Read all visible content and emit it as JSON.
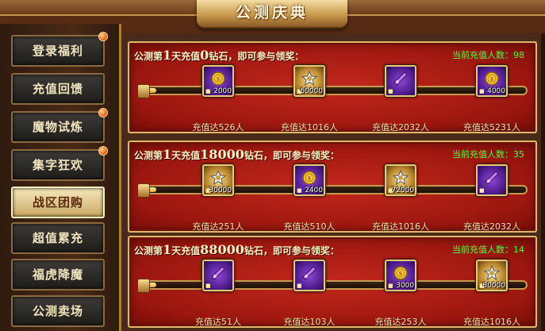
{
  "title": "公测庆典",
  "sidebar": {
    "items": [
      {
        "label": "登录福利",
        "badge": true,
        "active": false
      },
      {
        "label": "充值回馈",
        "badge": false,
        "active": false
      },
      {
        "label": "魔物试炼",
        "badge": true,
        "active": false
      },
      {
        "label": "集字狂欢",
        "badge": true,
        "active": false
      },
      {
        "label": "战区团购",
        "badge": false,
        "active": true
      },
      {
        "label": "超值累充",
        "badge": false,
        "active": false
      },
      {
        "label": "福虎降魔",
        "badge": false,
        "active": false
      },
      {
        "label": "公测卖场",
        "badge": false,
        "active": false
      }
    ]
  },
  "tiers": [
    {
      "title_pre": "公测第",
      "day": "1",
      "title_mid": "天充值",
      "amount": "0",
      "title_post": "钻石，即可参与领奖：",
      "count_label": "当前充值人数：",
      "count": "98",
      "progress": 0.03,
      "rewards": [
        {
          "kind": "coin",
          "frame": "purple",
          "qty": "2000",
          "requirement": "充值达526人"
        },
        {
          "kind": "emblem",
          "frame": "gold",
          "qty": "60000",
          "requirement": "充值达1016人"
        },
        {
          "kind": "potion",
          "frame": "purple",
          "qty": "",
          "requirement": "充值达2032人"
        },
        {
          "kind": "coin",
          "frame": "purple",
          "qty": "4000",
          "requirement": "充值达5231人"
        }
      ]
    },
    {
      "title_pre": "公测第",
      "day": "1",
      "title_mid": "天充值",
      "amount": "18000",
      "title_post": "钻石，即可参与领奖：",
      "count_label": "当前充值人数：",
      "count": "35",
      "progress": 0.03,
      "rewards": [
        {
          "kind": "emblem",
          "frame": "gold",
          "qty": "30000",
          "requirement": "充值达251人"
        },
        {
          "kind": "coin",
          "frame": "purple",
          "qty": "2400",
          "requirement": "充值达510人"
        },
        {
          "kind": "emblem",
          "frame": "gold",
          "qty": "72000",
          "requirement": "充值达1016人"
        },
        {
          "kind": "potion",
          "frame": "purple",
          "qty": "",
          "requirement": "充值达2032人"
        }
      ]
    },
    {
      "title_pre": "公测第",
      "day": "1",
      "title_mid": "天充值",
      "amount": "88000",
      "title_post": "钻石，即可参与领奖：",
      "count_label": "当前充值人数：",
      "count": "14",
      "progress": 0.03,
      "rewards": [
        {
          "kind": "potion",
          "frame": "purple",
          "qty": "",
          "requirement": "充值达51人"
        },
        {
          "kind": "potion",
          "frame": "purple",
          "qty": "",
          "requirement": "充值达103人"
        },
        {
          "kind": "coin",
          "frame": "purple",
          "qty": "3000",
          "requirement": "充值达253人"
        },
        {
          "kind": "emblem",
          "frame": "gold",
          "qty": "80000",
          "requirement": "充值达1016人"
        }
      ]
    }
  ],
  "colors": {
    "count": "#4cff3c",
    "panel": "#b0201a",
    "gold_border": "#e0b86a"
  }
}
